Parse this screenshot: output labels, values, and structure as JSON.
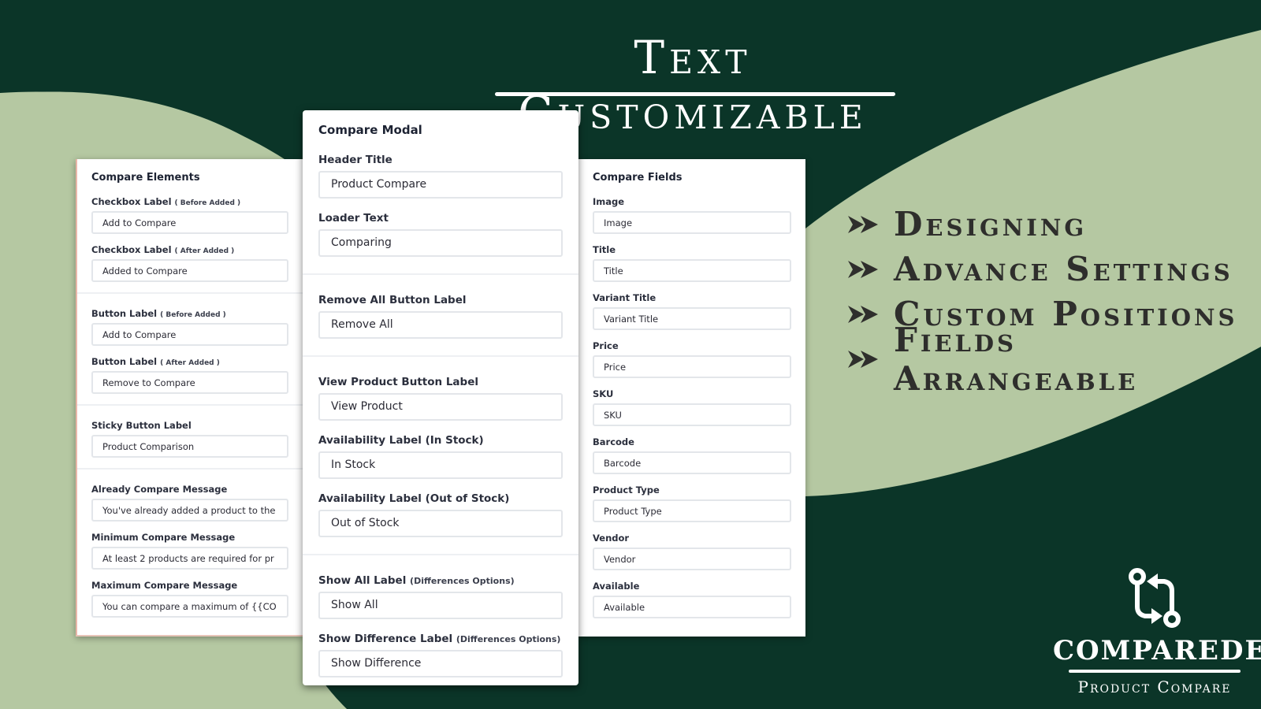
{
  "colors": {
    "background_dark": "#0b3528",
    "background_light": "#b7c9a3",
    "panel": "#ffffff",
    "heading_text": "#1d2333",
    "feature_text": "#2e2e2c"
  },
  "header": {
    "title": "Text Customizable"
  },
  "compare_elements": {
    "title": "Compare Elements",
    "sections": [
      {
        "fields": [
          {
            "label": "Checkbox Label",
            "sub": "( Before Added )",
            "value": "Add to Compare"
          },
          {
            "label": "Checkbox Label",
            "sub": "( After Added )",
            "value": "Added to Compare"
          }
        ]
      },
      {
        "fields": [
          {
            "label": "Button Label",
            "sub": "( Before Added )",
            "value": "Add to Compare"
          },
          {
            "label": "Button Label",
            "sub": "( After Added )",
            "value": "Remove to Compare"
          }
        ]
      },
      {
        "fields": [
          {
            "label": "Sticky Button Label",
            "sub": "",
            "value": "Product Comparison"
          }
        ]
      },
      {
        "fields": [
          {
            "label": "Already Compare Message",
            "sub": "",
            "value": "You've already added a product to the"
          },
          {
            "label": "Minimum Compare Message",
            "sub": "",
            "value": "At least 2 products are required for pr"
          },
          {
            "label": "Maximum Compare Message",
            "sub": "",
            "value": "You can compare a maximum of {{CO"
          }
        ]
      }
    ]
  },
  "compare_modal": {
    "title": "Compare Modal",
    "sections": [
      {
        "fields": [
          {
            "label": "Header Title",
            "sub": "",
            "value": "Product Compare"
          },
          {
            "label": "Loader Text",
            "sub": "",
            "value": "Comparing"
          }
        ]
      },
      {
        "fields": [
          {
            "label": "Remove All Button Label",
            "sub": "",
            "value": "Remove All"
          }
        ]
      },
      {
        "fields": [
          {
            "label": "View Product Button Label",
            "sub": "",
            "value": "View Product"
          },
          {
            "label": "Availability Label (In Stock)",
            "sub": "",
            "value": "In Stock"
          },
          {
            "label": "Availability Label (Out of Stock)",
            "sub": "",
            "value": "Out of Stock"
          }
        ]
      },
      {
        "fields": [
          {
            "label": "Show All Label",
            "sub": "(Differences Options)",
            "value": "Show All"
          },
          {
            "label": "Show Difference Label",
            "sub": "(Differences Options)",
            "value": "Show Difference"
          }
        ]
      }
    ]
  },
  "compare_fields": {
    "title": "Compare Fields",
    "fields": [
      {
        "label": "Image",
        "value": "Image"
      },
      {
        "label": "Title",
        "value": "Title"
      },
      {
        "label": "Variant Title",
        "value": "Variant Title"
      },
      {
        "label": "Price",
        "value": "Price"
      },
      {
        "label": "SKU",
        "value": "SKU"
      },
      {
        "label": "Barcode",
        "value": "Barcode"
      },
      {
        "label": "Product Type",
        "value": "Product Type"
      },
      {
        "label": "Vendor",
        "value": "Vendor"
      },
      {
        "label": "Available",
        "value": "Available"
      }
    ]
  },
  "features": {
    "bullet_icon": "double-arrow-right-icon",
    "items": [
      "Designing",
      "Advance Settings",
      "Custom Positions",
      "Fields Arrangeable"
    ]
  },
  "brand": {
    "icon": "compare-arrows-icon",
    "name": "COMPAREDER",
    "tagline": "Product Compare"
  }
}
